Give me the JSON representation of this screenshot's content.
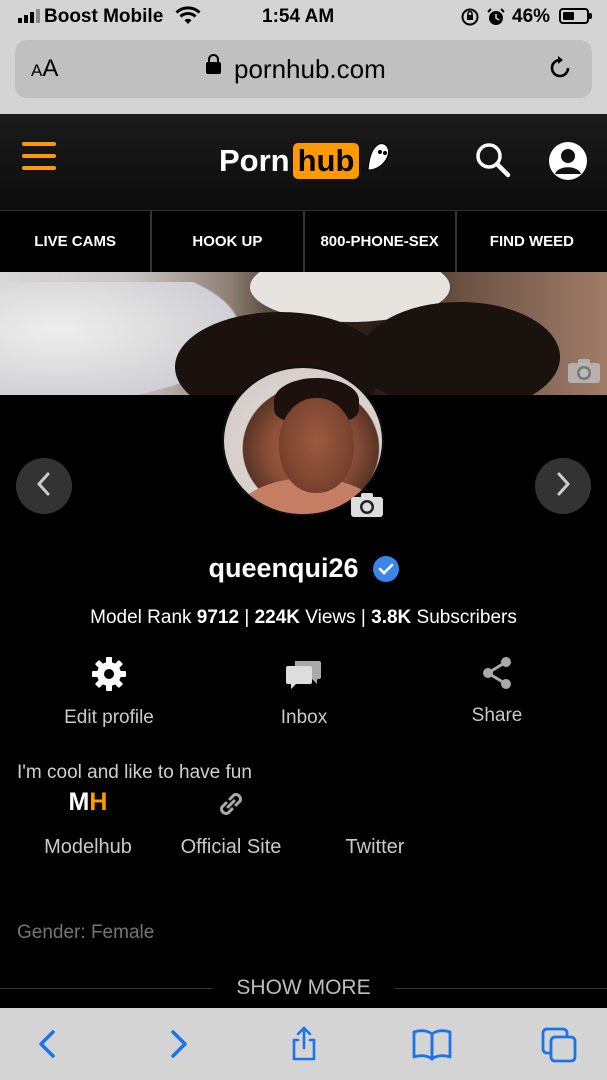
{
  "status_bar": {
    "carrier": "Boost Mobile",
    "time": "1:54 AM",
    "battery": "46%"
  },
  "browser": {
    "text_size_label": "AA",
    "domain": "pornhub.com"
  },
  "site": {
    "logo_part1": "Porn",
    "logo_part2": "hub",
    "accent_color": "#ff9900",
    "nav_tabs": [
      "LIVE CAMS",
      "HOOK UP",
      "800-PHONE-SEX",
      "FIND WEED"
    ]
  },
  "profile": {
    "username": "queenqui26",
    "verified": true,
    "rank_label": "Model Rank",
    "rank_value": "9712",
    "views_value": "224K",
    "views_label": "Views",
    "subscribers_value": "3.8K",
    "subscribers_label": "Subscribers",
    "bio": "I'm cool and like to have fun",
    "gender_label": "Gender:",
    "gender_value": "Female"
  },
  "actions": {
    "edit_profile": "Edit profile",
    "inbox": "Inbox",
    "share": "Share"
  },
  "links": {
    "modelhub_m": "M",
    "modelhub_h": "H",
    "modelhub": "Modelhub",
    "official_site": "Official Site",
    "twitter": "Twitter"
  },
  "show_more": "SHOW MORE",
  "icons": [
    "signal-icon",
    "wifi-icon",
    "orientation-lock-icon",
    "alarm-icon",
    "battery-icon",
    "lock-icon",
    "reload-icon",
    "hamburger-menu-icon",
    "search-icon",
    "user-account-icon",
    "camera-icon",
    "chevron-left-icon",
    "chevron-right-icon",
    "verified-check-icon",
    "gear-icon",
    "chat-bubbles-icon",
    "share-icon",
    "link-icon",
    "back-icon",
    "forward-icon",
    "share-sheet-icon",
    "bookmarks-icon",
    "tabs-icon"
  ]
}
